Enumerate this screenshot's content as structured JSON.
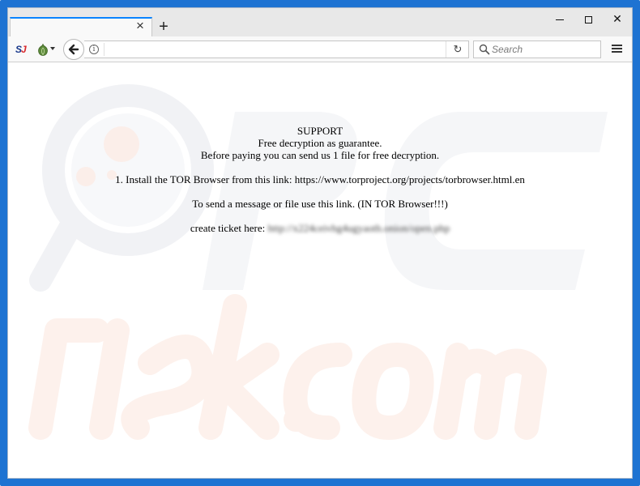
{
  "browser": {
    "tab": {
      "title": "",
      "close_label": "×"
    },
    "new_tab_label": "+",
    "window_controls": {
      "minimize_icon": "minimize-icon",
      "maximize_icon": "maximize-icon",
      "close_label": "✕"
    },
    "toolbar": {
      "extension_icon": "sj-icon",
      "tor_icon": "onion-icon",
      "back_icon": "back-arrow-icon",
      "info_label": "i",
      "url_value": "",
      "reload_label": "↻",
      "search_placeholder": "Search",
      "menu_icon": "hamburger-menu-icon"
    }
  },
  "page": {
    "lines": {
      "support": "SUPPORT",
      "guarantee": "Free decryption as guarantee.",
      "before_paying": "Before paying you can send us 1 file for free decryption.",
      "install_tor": "1. Install the TOR Browser from this link: https://www.torproject.org/projects/torbrowser.html.en",
      "send_message": "To send a message or file use this link. (IN TOR Browser!!!)",
      "ticket_label": "create ticket here:",
      "ticket_link": "http://x224ceivhg4ugyaoth.onion/open.php"
    }
  },
  "colors": {
    "window_border": "#1e73d2",
    "tab_accent": "#0a84ff",
    "watermark_grey": "#f2f3f5",
    "watermark_orange": "#fdf1ec"
  }
}
